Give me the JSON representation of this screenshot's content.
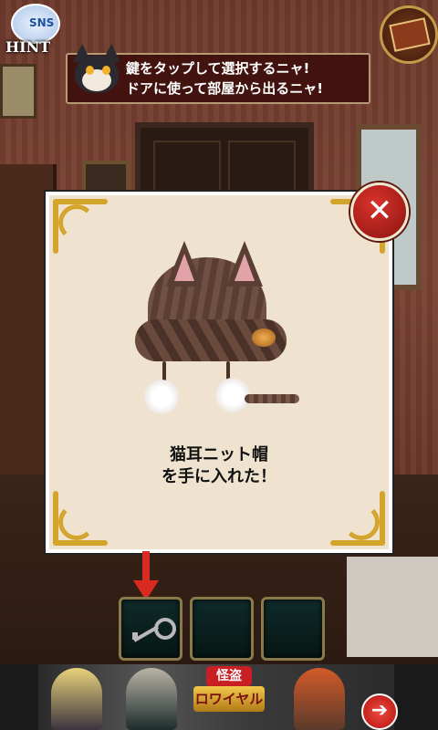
{
  "hud": {
    "hint_label": "HINT",
    "sns_label": "SNS",
    "message": {
      "line1": "鍵をタップして選択するニャ!",
      "line2": "ドアに使って部屋から出るニャ!"
    }
  },
  "modal": {
    "close_glyph": "✕",
    "item_name": "猫耳ニット帽",
    "item_message": "を手に入れた！"
  },
  "inventory": {
    "slots": [
      {
        "item": "key-icon",
        "selected": true
      },
      {
        "item": "",
        "selected": false
      },
      {
        "item": "",
        "selected": false
      }
    ]
  },
  "banner": {
    "logo_top": "怪盗",
    "logo_main": "ロワイヤル",
    "next_glyph": "➔"
  },
  "colors": {
    "close_button": "#c4221b",
    "modal_bg": "#efe3cf",
    "gold_trim": "#d4a52c",
    "selection_arrow": "#d82a20"
  }
}
